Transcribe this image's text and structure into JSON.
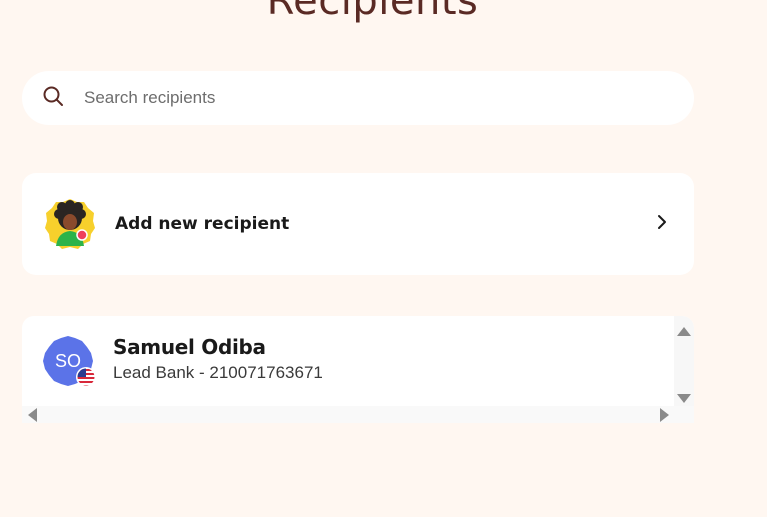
{
  "page": {
    "title": "Recipients"
  },
  "search": {
    "placeholder": "Search recipients",
    "icon": "search-icon"
  },
  "add_recipient": {
    "label": "Add new recipient",
    "icon": "chevron-right-icon"
  },
  "recipients": [
    {
      "initials": "SO",
      "name": "Samuel Odiba",
      "details": "Lead Bank - 210071763671",
      "avatar_color": "#5b73e8",
      "flag": "us-flag-icon"
    }
  ],
  "colors": {
    "background": "#fff7f1",
    "title": "#5a2a24",
    "avatar_yellow": "#f7d02c",
    "avatar_blue": "#5b73e8"
  }
}
